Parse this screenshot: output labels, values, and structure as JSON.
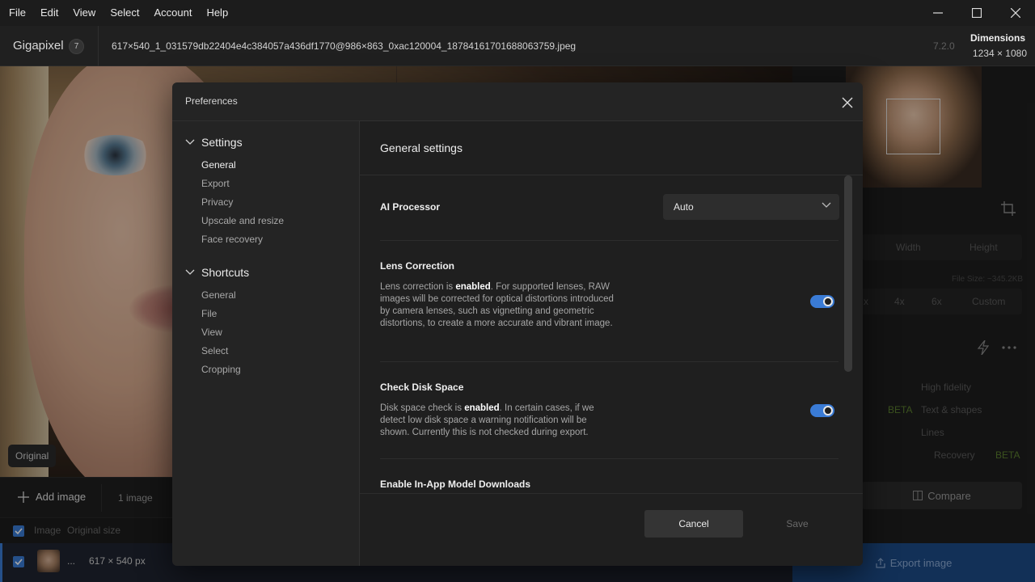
{
  "menubar": {
    "items": [
      "File",
      "Edit",
      "View",
      "Select",
      "Account",
      "Help"
    ]
  },
  "titlebar": {
    "app_name": "Gigapixel",
    "badge": "7",
    "filename": "617×540_1_031579db22404e4c384057a436df1770@986×863_0xac120004_18784161701688063759.jpeg",
    "version": "7.2.0",
    "dimensions_label": "Dimensions",
    "dimensions_value": "1234 × 1080"
  },
  "canvas": {
    "original_label": "Original"
  },
  "bottombar": {
    "add_image": "Add image",
    "image_count": "1 image",
    "columns": [
      "Image",
      "Original size"
    ],
    "row": {
      "ellipsis": "...",
      "size": "617 × 540 px"
    }
  },
  "right_panel": {
    "tabs": [
      "Width",
      "Height"
    ],
    "file_size": "File Size: ~345.2KB",
    "scale_options": [
      "x",
      "4x",
      "6x",
      "Custom"
    ],
    "models": [
      "High fidelity",
      "Text & shapes",
      "Lines",
      "Recovery"
    ],
    "beta_label": "BETA",
    "compare": "Compare",
    "export": "Export image"
  },
  "modal": {
    "title": "Preferences",
    "nav": {
      "settings": {
        "label": "Settings",
        "items": [
          "General",
          "Export",
          "Privacy",
          "Upscale and resize",
          "Face recovery"
        ]
      },
      "shortcuts": {
        "label": "Shortcuts",
        "items": [
          "General",
          "File",
          "View",
          "Select",
          "Cropping"
        ]
      }
    },
    "content": {
      "title": "General settings",
      "ai_processor": {
        "label": "AI Processor",
        "value": "Auto"
      },
      "lens_correction": {
        "label": "Lens Correction",
        "desc_pre": "Lens correction is ",
        "desc_bold": "enabled",
        "desc_post": ". For supported lenses, RAW images will be corrected for optical distortions introduced by camera lenses, such as vignetting and geometric distortions, to create a more accurate and vibrant image.",
        "enabled": true
      },
      "disk_space": {
        "label": "Check Disk Space",
        "desc_pre": "Disk space check is ",
        "desc_bold": "enabled",
        "desc_post": ". In certain cases, if we detect low disk space a warning notification will be shown. Currently this is not checked during export.",
        "enabled": true
      },
      "model_downloads": {
        "label": "Enable In-App Model Downloads"
      }
    },
    "footer": {
      "cancel": "Cancel",
      "save": "Save"
    }
  },
  "colors": {
    "accent": "#3a7bd5",
    "beta": "#6fa83a",
    "bg": "#1a1a1a",
    "modal_bg": "#242424"
  }
}
